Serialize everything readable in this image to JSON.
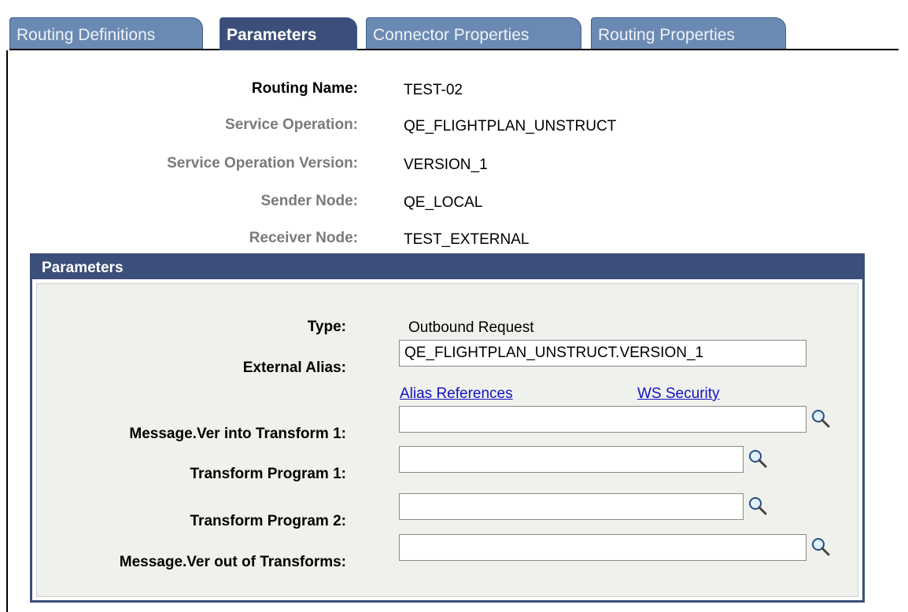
{
  "tabs": [
    {
      "label": "Routing Definitions",
      "active": false
    },
    {
      "label": "Parameters",
      "active": true
    },
    {
      "label": "Connector Properties",
      "active": false
    },
    {
      "label": "Routing Properties",
      "active": false
    }
  ],
  "header_fields": {
    "routing_name": {
      "label": "Routing Name:",
      "value": "TEST-02"
    },
    "service_operation": {
      "label": "Service Operation:",
      "value": "QE_FLIGHTPLAN_UNSTRUCT"
    },
    "service_operation_version": {
      "label": "Service Operation Version:",
      "value": "VERSION_1"
    },
    "sender_node": {
      "label": "Sender Node:",
      "value": "QE_LOCAL"
    },
    "receiver_node": {
      "label": "Receiver Node:",
      "value": "TEST_EXTERNAL"
    }
  },
  "parameters": {
    "title": "Parameters",
    "type": {
      "label": "Type:",
      "value": "Outbound Request"
    },
    "external_alias": {
      "label": "External Alias:",
      "value": "QE_FLIGHTPLAN_UNSTRUCT.VERSION_1"
    },
    "links": {
      "alias_references": "Alias References",
      "ws_security": "WS Security"
    },
    "message_ver_into_transform_1": {
      "label": "Message.Ver into Transform 1:",
      "value": ""
    },
    "transform_program_1": {
      "label": "Transform Program 1:",
      "value": ""
    },
    "transform_program_2": {
      "label": "Transform Program 2:",
      "value": ""
    },
    "message_ver_out_of_transforms": {
      "label": "Message.Ver out of Transforms:",
      "value": ""
    }
  },
  "icons": {
    "lookup": "magnifier-lookup-icon"
  },
  "colors": {
    "tab_inactive": "#6b8ab3",
    "tab_active": "#3c4f7a",
    "panel_header": "#3c4f7a",
    "panel_body": "#eff1ec",
    "link": "#1212c4",
    "dim_label": "#7a7a7a"
  }
}
